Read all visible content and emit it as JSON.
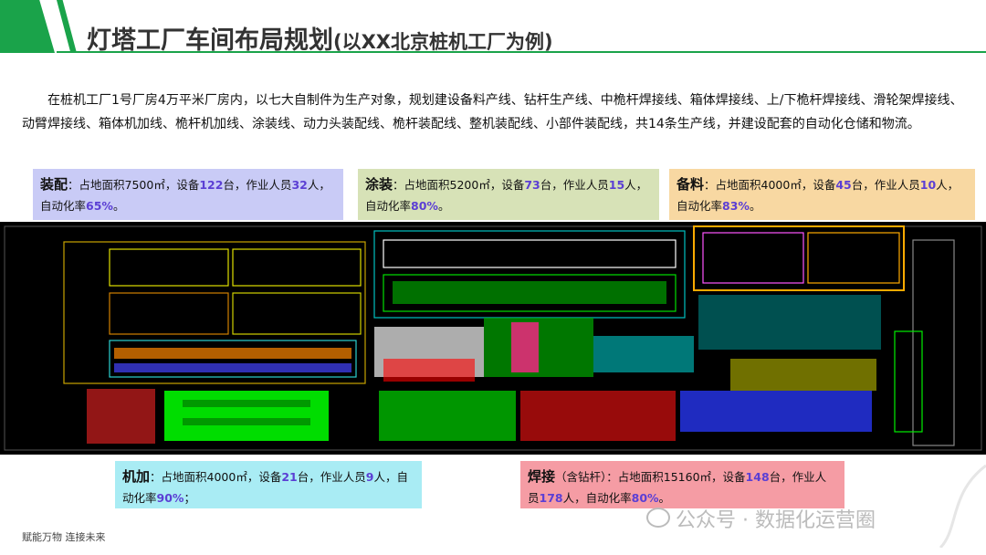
{
  "header": {
    "title": "灯塔工厂车间布局规划",
    "subtitle": "(以XX北京桩机工厂为例)"
  },
  "intro": "在桩机工厂1号厂房4万平米厂房内，以七大自制件为生产对象，规划建设备料产线、钻杆生产线、中桅杆焊接线、箱体焊接线、上/下桅杆焊接线、滑轮架焊接线、动臂焊接线、箱体机加线、桅杆机加线、涂装线、动力头装配线、桅杆装配线、整机装配线、小部件装配线，共14条生产线，并建设配套的自动化仓储和物流。",
  "boxes": {
    "assembly": {
      "name": "装配",
      "t1": "：占地面积7500㎡，设备",
      "equip": "122",
      "t2": "台，作业人员",
      "staff": "32",
      "t3": "人，自动化率",
      "rate": "65%",
      "t4": "。"
    },
    "coating": {
      "name": "涂装",
      "t1": "：占地面积5200㎡，设备",
      "equip": "73",
      "t2": "台，作业人员",
      "staff": "15",
      "t3": "人，自动化率",
      "rate": "80%",
      "t4": "。"
    },
    "material": {
      "name": "备料",
      "t1": "：占地面积4000㎡，设备",
      "equip": "45",
      "t2": "台，作业人员",
      "staff": "10",
      "t3": "人，自动化率",
      "rate": "83%",
      "t4": "。"
    },
    "machining": {
      "name": "机加",
      "t1": "：占地面积4000㎡，设备",
      "equip": "21",
      "t2": "台，作业人员",
      "staff": "9",
      "t3": "人，自动化率",
      "rate": "90%",
      "t4": "；"
    },
    "welding": {
      "name": "焊接",
      "suffix": "（含钻杆）",
      "t1": "：占地面积15160㎡，设备",
      "equip": "148",
      "t2": "台，作业人员",
      "staff": "178",
      "t3": "人，自动化率",
      "rate": "80%",
      "t4": "。"
    }
  },
  "footer": "赋能万物  连接未来",
  "watermark": "公众号 · 数据化运营圈",
  "colors": {
    "accent": "#1aa34a",
    "number": "#5b3fd4"
  }
}
